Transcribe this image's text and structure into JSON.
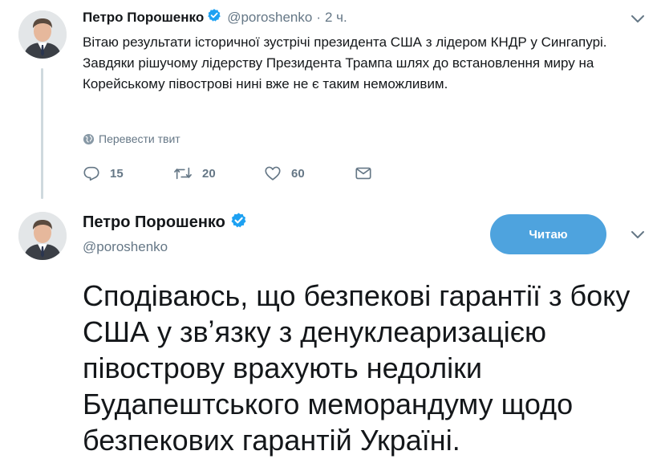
{
  "tweet1": {
    "author_name": "Петро Порошенко",
    "handle": "@poroshenko",
    "separator": "·",
    "time": "2 ч.",
    "text": "Вітаю результати історичної зустрічі президента США з лідером КНДР у Сингапурі. Завдяки рішучому лідерству Президента Трампа шлях до встановлення миру на Корейському півострові нині вже не є таким неможливим.",
    "translate_label": "Перевести твит",
    "replies": "15",
    "retweets": "20",
    "likes": "60"
  },
  "tweet2": {
    "author_name": "Петро Порошенко",
    "handle": "@poroshenko",
    "follow_label": "Читаю",
    "text": "Сподіваюсь, що безпекові гарантії з боку США у звʼязку з денуклеаризацією півострову врахують недоліки Будапештського меморандуму щодо безпекових гарантій Україні."
  },
  "icons": {
    "verified": "verified-badge-icon",
    "more": "chevron-down-icon",
    "globe": "globe-icon",
    "reply": "reply-icon",
    "retweet": "retweet-icon",
    "like": "heart-icon",
    "dm": "envelope-icon"
  },
  "colors": {
    "accent": "#1da1f2",
    "follow_button": "#4ea3de",
    "muted_text": "#657786",
    "thread_line": "#cfd9de"
  }
}
